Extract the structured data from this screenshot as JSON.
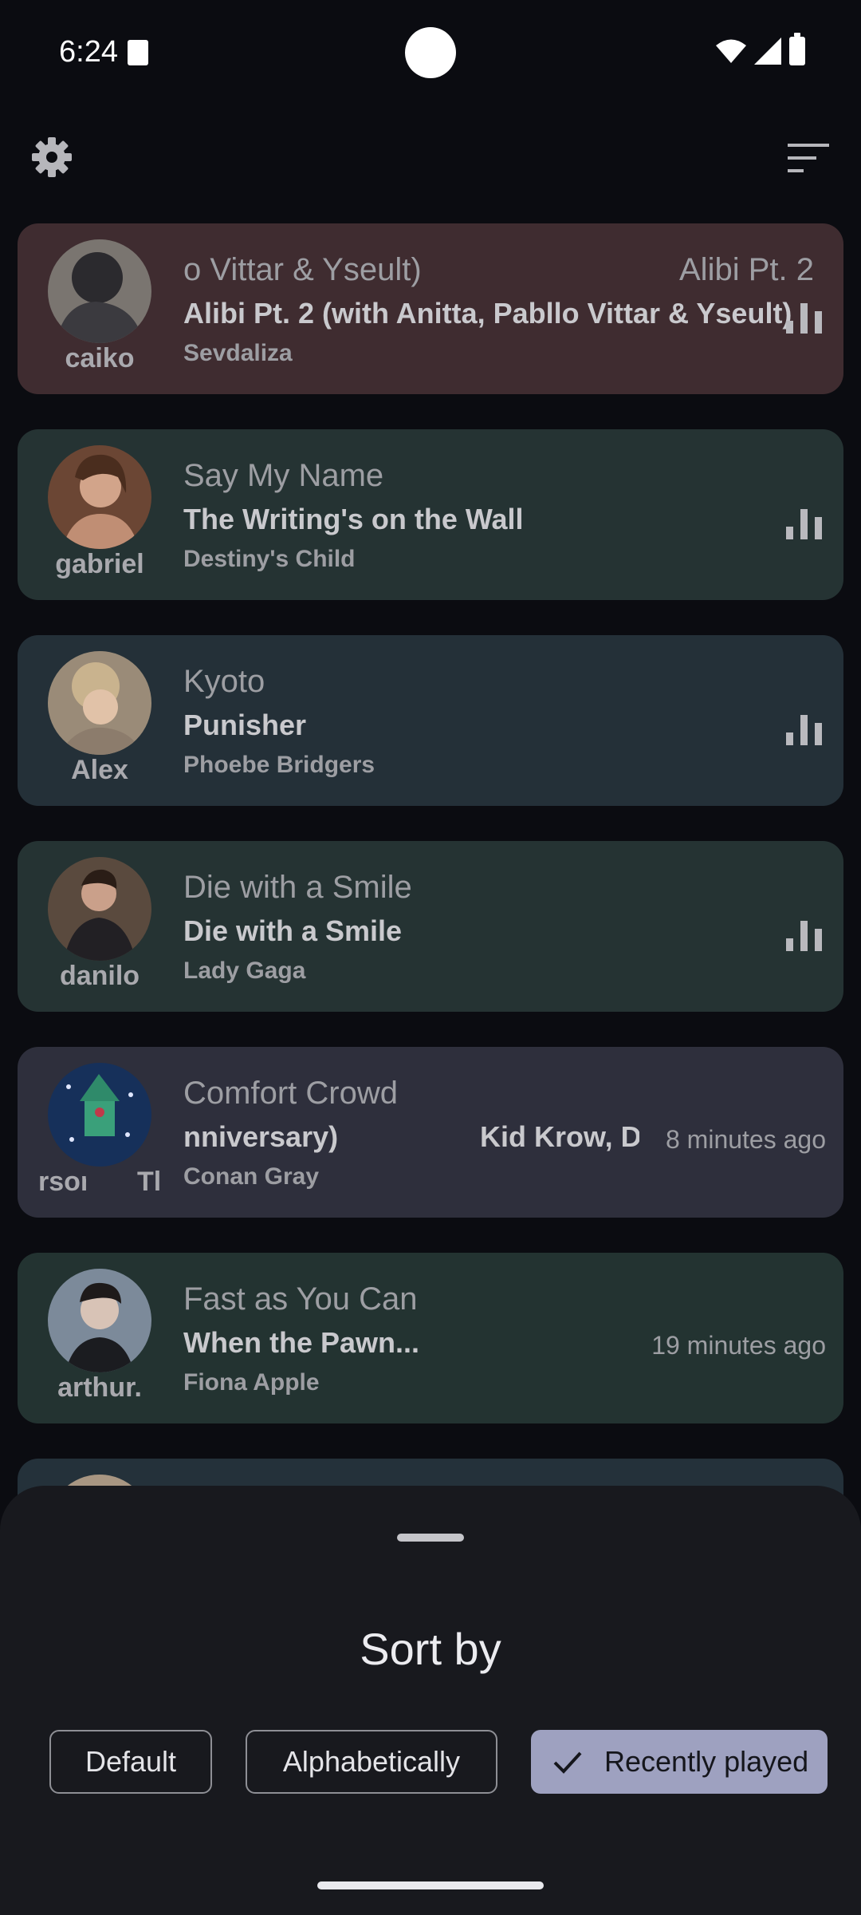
{
  "status_bar": {
    "time": "6:24"
  },
  "cards": [
    {
      "user": "caiko",
      "marquee_left": "o Vittar & Yseult)",
      "marquee_right": "Alibi Pt. 2 (",
      "album": "Alibi Pt. 2 (with Anitta, Pabllo Vittar & Yseult)",
      "artist": "Sevdaliza",
      "now_playing": true,
      "bg": "#3f2c30"
    },
    {
      "user": "gabriel",
      "track": "Say My Name",
      "album": "The Writing's on the Wall",
      "artist": "Destiny's Child",
      "now_playing": true,
      "bg": "#253333"
    },
    {
      "user": "Alex",
      "track": "Kyoto",
      "album": "Punisher",
      "artist": "Phoebe Bridgers",
      "now_playing": true,
      "bg": "#243038"
    },
    {
      "user": "danilo",
      "track": "Die with a Smile",
      "album": "Die with a Smile",
      "artist": "Lady Gaga",
      "now_playing": true,
      "bg": "#253333"
    },
    {
      "user_left": "rson",
      "user_right": "Tl",
      "track": "Comfort Crowd",
      "album_left": "nniversary)",
      "album_right": "Kid Krow, De",
      "artist": "Conan Gray",
      "time_ago": "8 minutes ago",
      "bg": "#2e2f3c"
    },
    {
      "user": "arthur.",
      "track": "Fast as You Can",
      "album": "When the Pawn...",
      "artist": "Fiona Apple",
      "time_ago": "19 minutes ago",
      "bg": "#233331"
    }
  ],
  "sort_sheet": {
    "title": "Sort by",
    "options": [
      "Default",
      "Alphabetically",
      "Recently played"
    ],
    "selected": "Recently played"
  },
  "icons": {
    "settings": "gear-icon",
    "sort": "sort-lines-icon",
    "now_playing": "equalizer-bars-icon",
    "selected": "check-icon"
  }
}
